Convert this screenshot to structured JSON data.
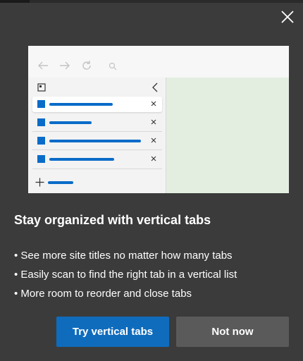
{
  "dialog": {
    "title": "Stay organized with vertical tabs",
    "bullets": [
      "• See more site titles no matter how many tabs",
      "• Easily scan to find the right tab in a vertical list",
      "• More room to reorder and close tabs"
    ],
    "primary_button": "Try vertical tabs",
    "secondary_button": "Not now"
  },
  "illustration": {
    "tabs": [
      {
        "active": true
      },
      {
        "active": false
      },
      {
        "active": false
      },
      {
        "active": false
      }
    ],
    "close_glyph": "×",
    "icons": [
      "back-arrow-icon",
      "forward-arrow-icon",
      "refresh-icon",
      "search-icon",
      "tab-actions-icon",
      "collapse-chevron-icon",
      "new-tab-plus-icon"
    ]
  },
  "colors": {
    "background": "#3b3b3b",
    "accent": "#0f6cbd",
    "secondary_button": "#5a5a5a",
    "tab_blue": "#0a6cc8",
    "content_pane": "#e3eee1"
  }
}
